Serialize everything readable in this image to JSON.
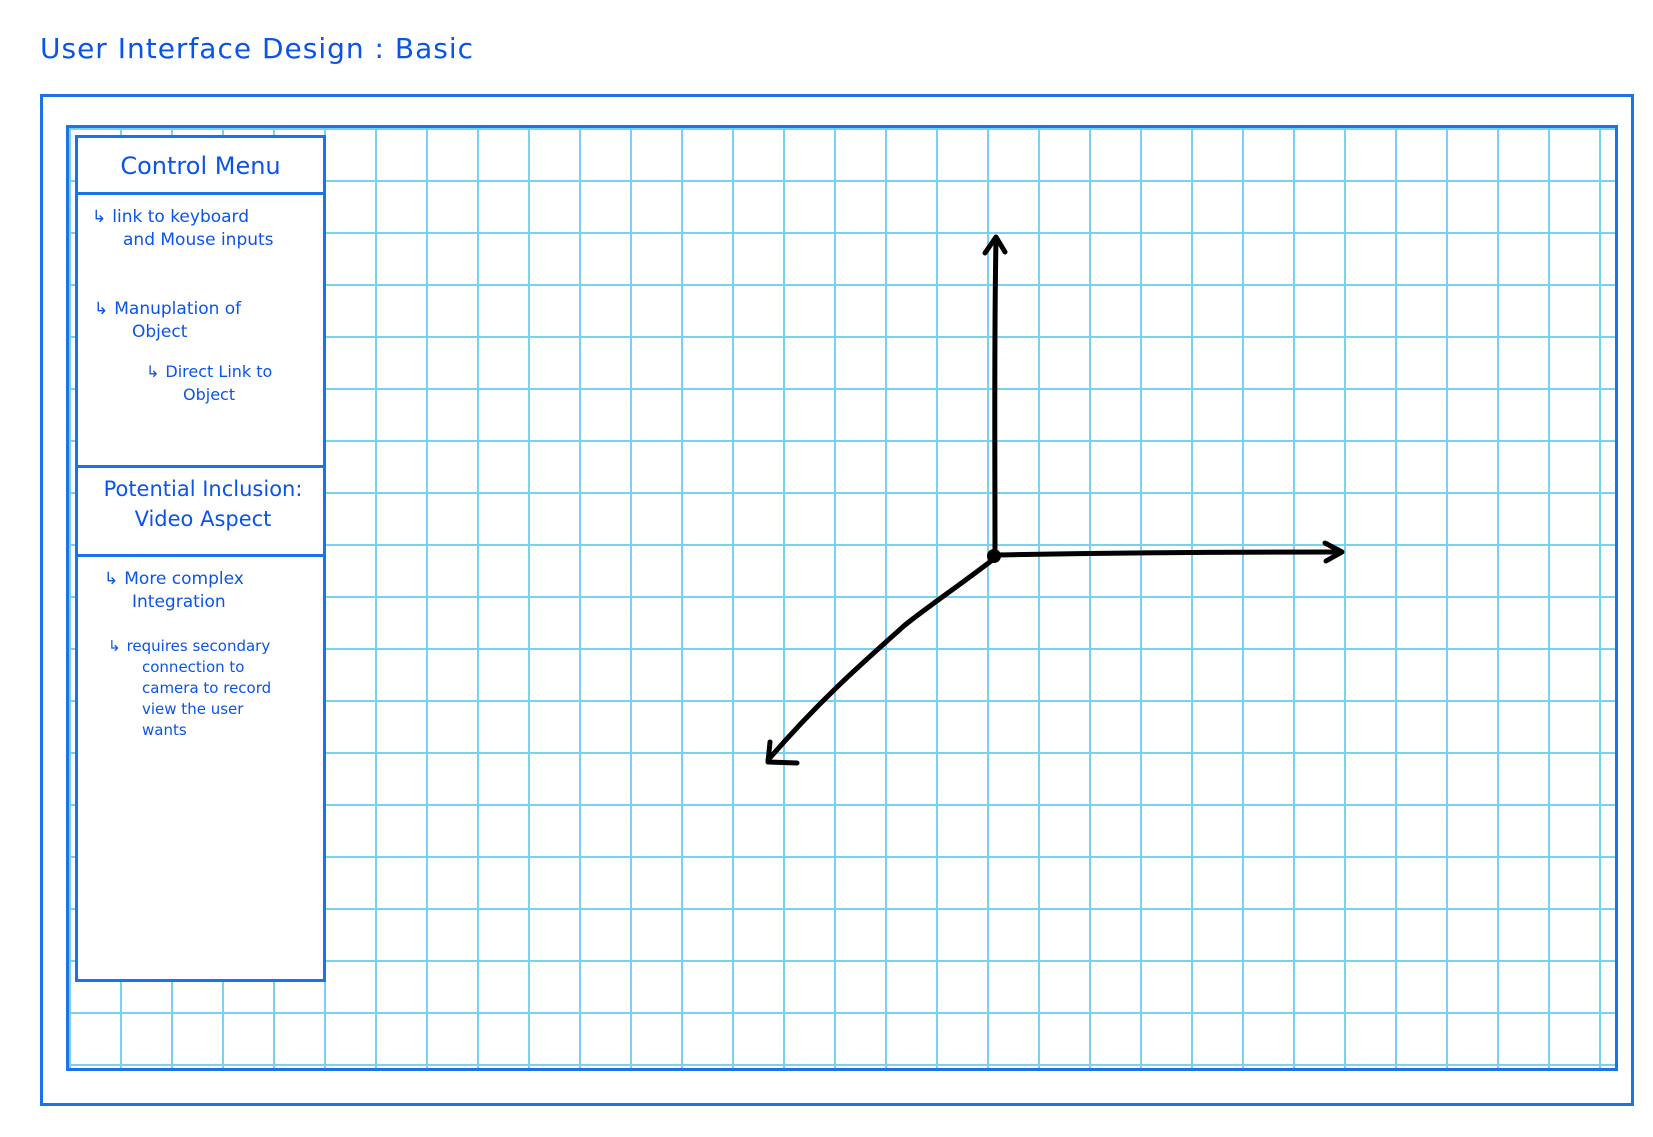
{
  "page": {
    "title": "User Interface Design : Basic"
  },
  "sidebar": {
    "control_menu": {
      "title": "Control Menu",
      "items": [
        {
          "lines": [
            "link to keyboard",
            "and Mouse inputs"
          ]
        },
        {
          "lines": [
            "Manuplation of",
            "Object"
          ]
        }
      ],
      "sub_items": [
        {
          "lines": [
            "Direct Link to",
            "Object"
          ]
        }
      ]
    },
    "potential_inclusion": {
      "title_line1": "Potential Inclusion:",
      "title_line2": "Video Aspect",
      "items": [
        {
          "lines": [
            "More complex",
            "Integration"
          ]
        },
        {
          "lines": [
            "requires secondary",
            "connection to",
            "camera to record",
            "view the user",
            "wants"
          ]
        }
      ]
    }
  },
  "viewport": {
    "grid_color": "#79d0f2",
    "axes_color": "#000000",
    "axes": [
      "y-axis-up",
      "x-axis-right",
      "z-axis-diagonal"
    ]
  },
  "colors": {
    "ink_blue": "#0a55e8",
    "frame_blue": "#1b73e8",
    "grid_cyan": "#79d0f2"
  }
}
